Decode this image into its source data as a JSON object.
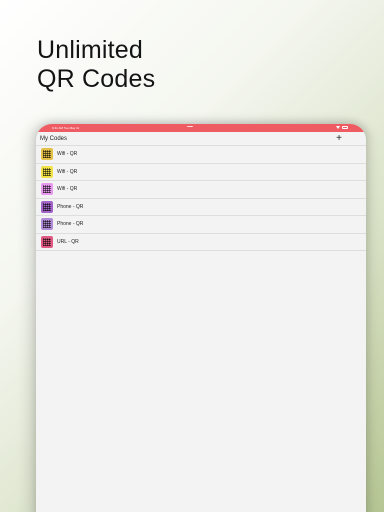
{
  "headline": {
    "line1": "Unlimited",
    "line2": "QR Codes"
  },
  "status_bar": {
    "time": "9:41 AM  Tue May 11",
    "color": "#ef5b62"
  },
  "nav": {
    "title": "My Codes",
    "add_label": "+"
  },
  "codes": [
    {
      "label": "Wifi - QR",
      "icon": "qr-code-icon",
      "color": "#e3c04a"
    },
    {
      "label": "Wifi - QR",
      "icon": "qr-code-icon",
      "color": "#f2e24a"
    },
    {
      "label": "Wifi - QR",
      "icon": "qr-code-icon",
      "color": "#e799ee"
    },
    {
      "label": "Phone - QR",
      "icon": "qr-code-icon",
      "color": "#a264c9"
    },
    {
      "label": "Phone - QR",
      "icon": "qr-code-icon",
      "color": "#b18cd6"
    },
    {
      "label": "URL - QR",
      "icon": "qr-code-icon",
      "color": "#e05a84"
    }
  ]
}
